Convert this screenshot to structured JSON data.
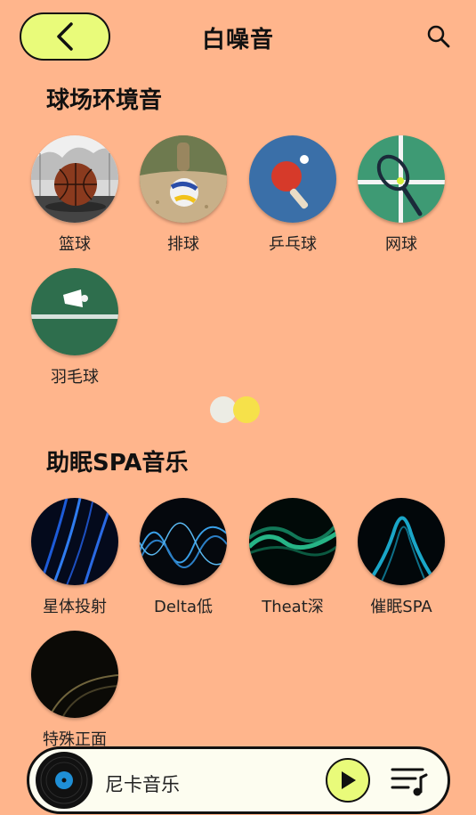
{
  "header": {
    "title": "白噪音"
  },
  "sections": [
    {
      "title": "球场环境音",
      "items": [
        {
          "label": "篮球",
          "icon": "basketball-image"
        },
        {
          "label": "排球",
          "icon": "volleyball-image"
        },
        {
          "label": "乒乓球",
          "icon": "table-tennis-image"
        },
        {
          "label": "网球",
          "icon": "tennis-image"
        },
        {
          "label": "羽毛球",
          "icon": "badminton-image"
        }
      ]
    },
    {
      "title": "助眠SPA音乐",
      "items": [
        {
          "label": "星体投射",
          "icon": "blue-light-waves-image"
        },
        {
          "label": "Delta低",
          "icon": "blue-sine-waves-image"
        },
        {
          "label": "Theat深",
          "icon": "green-glow-waves-image"
        },
        {
          "label": "催眠SPA",
          "icon": "teal-light-curve-image"
        },
        {
          "label": "特殊正面",
          "icon": "dark-gold-curve-image"
        }
      ]
    }
  ],
  "pager": {
    "pages": 2,
    "active_index": 1
  },
  "player": {
    "title": "尼卡音乐"
  },
  "colors": {
    "background": "#FFB58C",
    "accent": "#E9FB7A",
    "player_bg": "#FDFDF0",
    "pager_inactive": "#ECECE4",
    "pager_active": "#F6E14A"
  }
}
